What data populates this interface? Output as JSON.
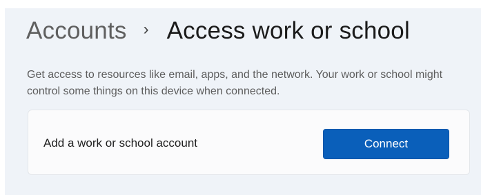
{
  "header": {
    "breadcrumb_parent": "Accounts",
    "breadcrumb_separator": "›",
    "page_title": "Access work or school"
  },
  "description": "Get access to resources like email, apps, and the network. Your work or school might control some things on this device when connected.",
  "work_school_card": {
    "label": "Add a work or school account",
    "connect_label": "Connect"
  },
  "colors": {
    "accent": "#0a5fba",
    "background": "#eff3f8",
    "card": "#fbfbfc"
  }
}
